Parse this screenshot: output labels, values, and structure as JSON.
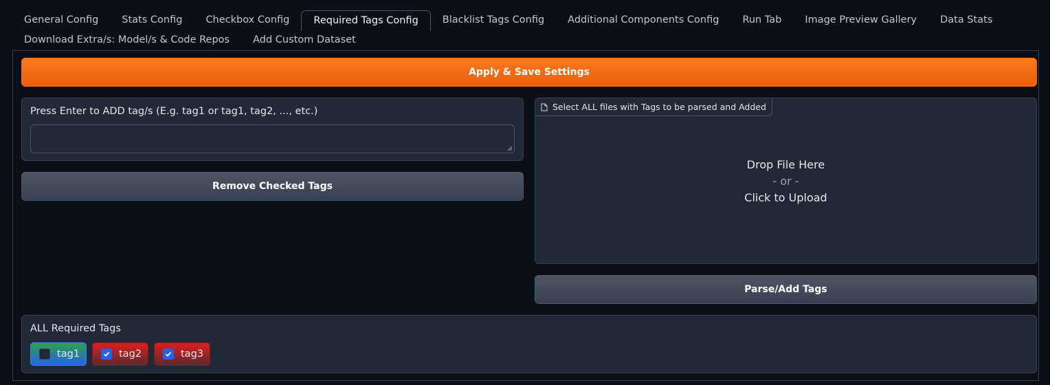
{
  "tabs": {
    "row1": [
      "General Config",
      "Stats Config",
      "Checkbox Config",
      "Required Tags Config",
      "Blacklist Tags Config",
      "Additional Components Config",
      "Run Tab",
      "Image Preview Gallery",
      "Data Stats"
    ],
    "row2": [
      "Download Extra/s: Model/s & Code Repos",
      "Add Custom Dataset"
    ],
    "active": "Required Tags Config"
  },
  "apply_button": "Apply & Save Settings",
  "tag_input": {
    "label": "Press Enter to ADD tag/s (E.g. tag1 or tag1, tag2, ..., etc.)",
    "value": ""
  },
  "remove_button": "Remove Checked Tags",
  "file_upload": {
    "label": "Select ALL files with Tags to be parsed and Added",
    "line1": "Drop File Here",
    "line2": "- or -",
    "line3": "Click to Upload",
    "icon": "file-icon"
  },
  "parse_button": "Parse/Add Tags",
  "required_tags": {
    "label": "ALL Required Tags",
    "items": [
      {
        "name": "tag1",
        "checked": false
      },
      {
        "name": "tag2",
        "checked": true
      },
      {
        "name": "tag3",
        "checked": true
      }
    ]
  },
  "colors": {
    "accent_orange": "#f97316",
    "checkbox_blue": "#2563eb",
    "background": "#0b0f19",
    "panel": "#1f2937"
  }
}
